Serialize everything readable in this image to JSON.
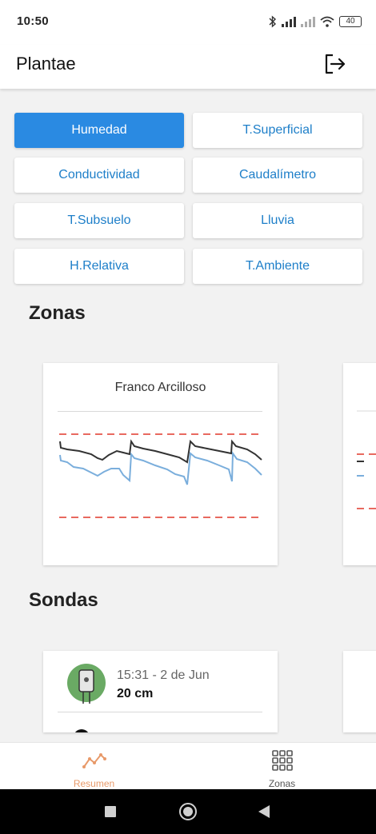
{
  "status": {
    "time": "10:50",
    "battery": "40"
  },
  "appbar": {
    "title": "Plantae"
  },
  "metrics": [
    {
      "label": "Humedad",
      "active": true
    },
    {
      "label": "T.Superficial",
      "active": false
    },
    {
      "label": "Conductividad",
      "active": false
    },
    {
      "label": "Caudalímetro",
      "active": false
    },
    {
      "label": "T.Subsuelo",
      "active": false
    },
    {
      "label": "Lluvia",
      "active": false
    },
    {
      "label": "H.Relativa",
      "active": false
    },
    {
      "label": "T.Ambiente",
      "active": false
    }
  ],
  "zonas": {
    "title": "Zonas",
    "card_title": "Franco Arcilloso"
  },
  "sondas": {
    "title": "Sondas",
    "probe": {
      "time": "15:31 - 2 de Jun",
      "depth": "20 cm"
    }
  },
  "bottomnav": {
    "resumen": "Resumen",
    "zonas": "Zonas",
    "active_color": "#e89a6a",
    "inactive_color": "#555555"
  },
  "colors": {
    "accent": "#2a8ae2",
    "link": "#1e7fc9",
    "threshold": "#e8695f",
    "series_dark": "#333333",
    "series_blue": "#7aaedc"
  }
}
